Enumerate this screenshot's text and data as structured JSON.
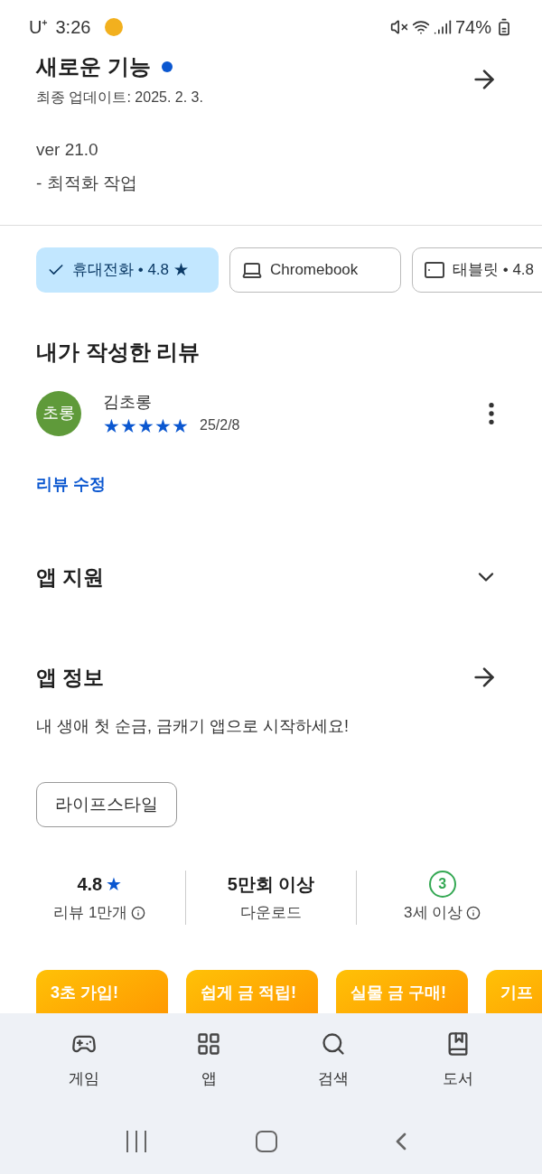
{
  "status_bar": {
    "carrier": "U⁺",
    "time": "3:26",
    "battery": "74%"
  },
  "whats_new": {
    "title": "새로운 기능",
    "unread": true,
    "updated": "최종 업데이트: 2025. 2. 3.",
    "lines": [
      "ver 21.0",
      "- 최적화 작업"
    ]
  },
  "device_chips": [
    {
      "kind": "phone",
      "label": "휴대전화 • 4.8 ★",
      "selected": true
    },
    {
      "kind": "laptop",
      "label": "Chromebook",
      "selected": false
    },
    {
      "kind": "tablet",
      "label": "태블릿 • 4.8",
      "selected": false
    }
  ],
  "my_review": {
    "heading": "내가 작성한 리뷰",
    "avatar": "초롱",
    "author": "김초롱",
    "stars": 5,
    "date": "25/2/8",
    "edit_link": "리뷰 수정"
  },
  "app_support": {
    "title": "앱 지원",
    "expanded": false
  },
  "app_info": {
    "title": "앱 정보",
    "description": "내 생애 첫 순금, 금캐기 앱으로 시작하세요!",
    "category": "라이프스타일"
  },
  "stats": [
    {
      "kind": "rating",
      "value": "4.8",
      "star": "★",
      "label": "리뷰 1만개"
    },
    {
      "kind": "downloads",
      "value": "5만회 이상",
      "label": "다운로드"
    },
    {
      "kind": "age",
      "value": "3",
      "label": "3세 이상"
    }
  ],
  "screenshots": [
    {
      "title": "3초 가입!"
    },
    {
      "title": "쉽게 금 적립!"
    },
    {
      "title": "실물 금 구매!"
    },
    {
      "title": "기프"
    }
  ],
  "bottom_nav": [
    {
      "kind": "games",
      "label": "게임",
      "selected": false
    },
    {
      "kind": "apps",
      "label": "앱",
      "selected": false
    },
    {
      "kind": "search",
      "label": "검색",
      "selected": false
    },
    {
      "kind": "books",
      "label": "도서",
      "selected": false
    }
  ]
}
